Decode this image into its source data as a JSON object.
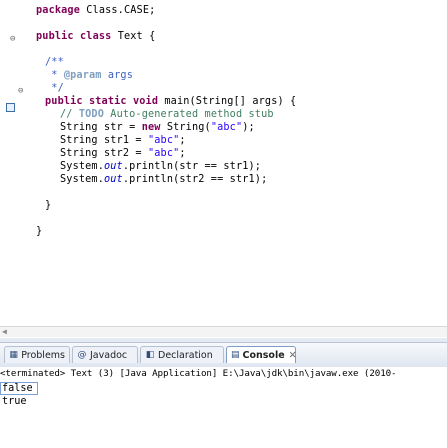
{
  "editor": {
    "lines": {
      "l1_kw": "package",
      "l1_rest": " Class.CASE;",
      "l2_kw1": "public",
      "l2_kw2": "class",
      "l2_rest": " Text {",
      "l3": "/**",
      "l4_a": " * ",
      "l4_tag": "@param",
      "l4_b": " args",
      "l5": " */",
      "l6_kw": "public static void",
      "l6_rest": " main(String[] args) {",
      "l7_a": "// ",
      "l7_todo": "TODO",
      "l7_b": " Auto-generated method stub",
      "l8_a": "String str = ",
      "l8_kw": "new",
      "l8_b": " String(",
      "l8_str": "\"abc\"",
      "l8_c": ");",
      "l9_a": "String str1 = ",
      "l9_str": "\"abc\"",
      "l9_b": ";",
      "l10_a": "String str2 = ",
      "l10_str": "\"abc\"",
      "l10_b": ";",
      "l11_a": "System.",
      "l11_fld": "out",
      "l11_b": ".println(str == str1);",
      "l12_a": "System.",
      "l12_fld": "out",
      "l12_b": ".println(str2 == str1);",
      "l13": "}",
      "l14": "}"
    }
  },
  "views": {
    "tabs": [
      {
        "label": "Problems",
        "icon": "problems-icon"
      },
      {
        "label": "Javadoc",
        "icon": "javadoc-icon"
      },
      {
        "label": "Declaration",
        "icon": "declaration-icon"
      },
      {
        "label": "Console",
        "icon": "console-icon"
      }
    ],
    "close_symbol": "✕"
  },
  "console": {
    "header": "<terminated> Text (3) [Java Application] E:\\Java\\jdk\\bin\\javaw.exe (2010-",
    "output": [
      "false",
      "true"
    ]
  },
  "colors": {
    "keyword": "#7f0055",
    "comment": "#3f7f5f",
    "javadoc": "#3f5fbf",
    "string": "#2a00ff",
    "field": "#0000c0"
  }
}
